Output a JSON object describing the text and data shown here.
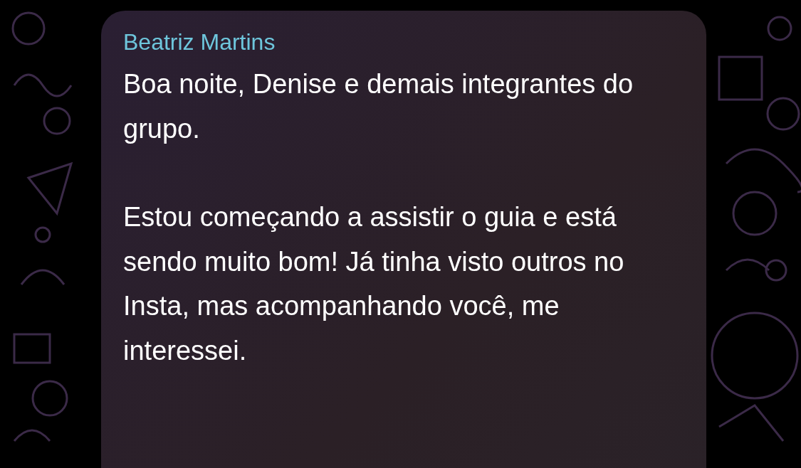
{
  "message": {
    "sender": "Beatriz Martins",
    "paragraphs": [
      "Boa noite, Denise e demais integrantes do grupo.",
      "Estou começando a assistir o guia e está sendo muito bom! Já tinha visto outros no Insta, mas acompanhando você, me interessei."
    ]
  }
}
